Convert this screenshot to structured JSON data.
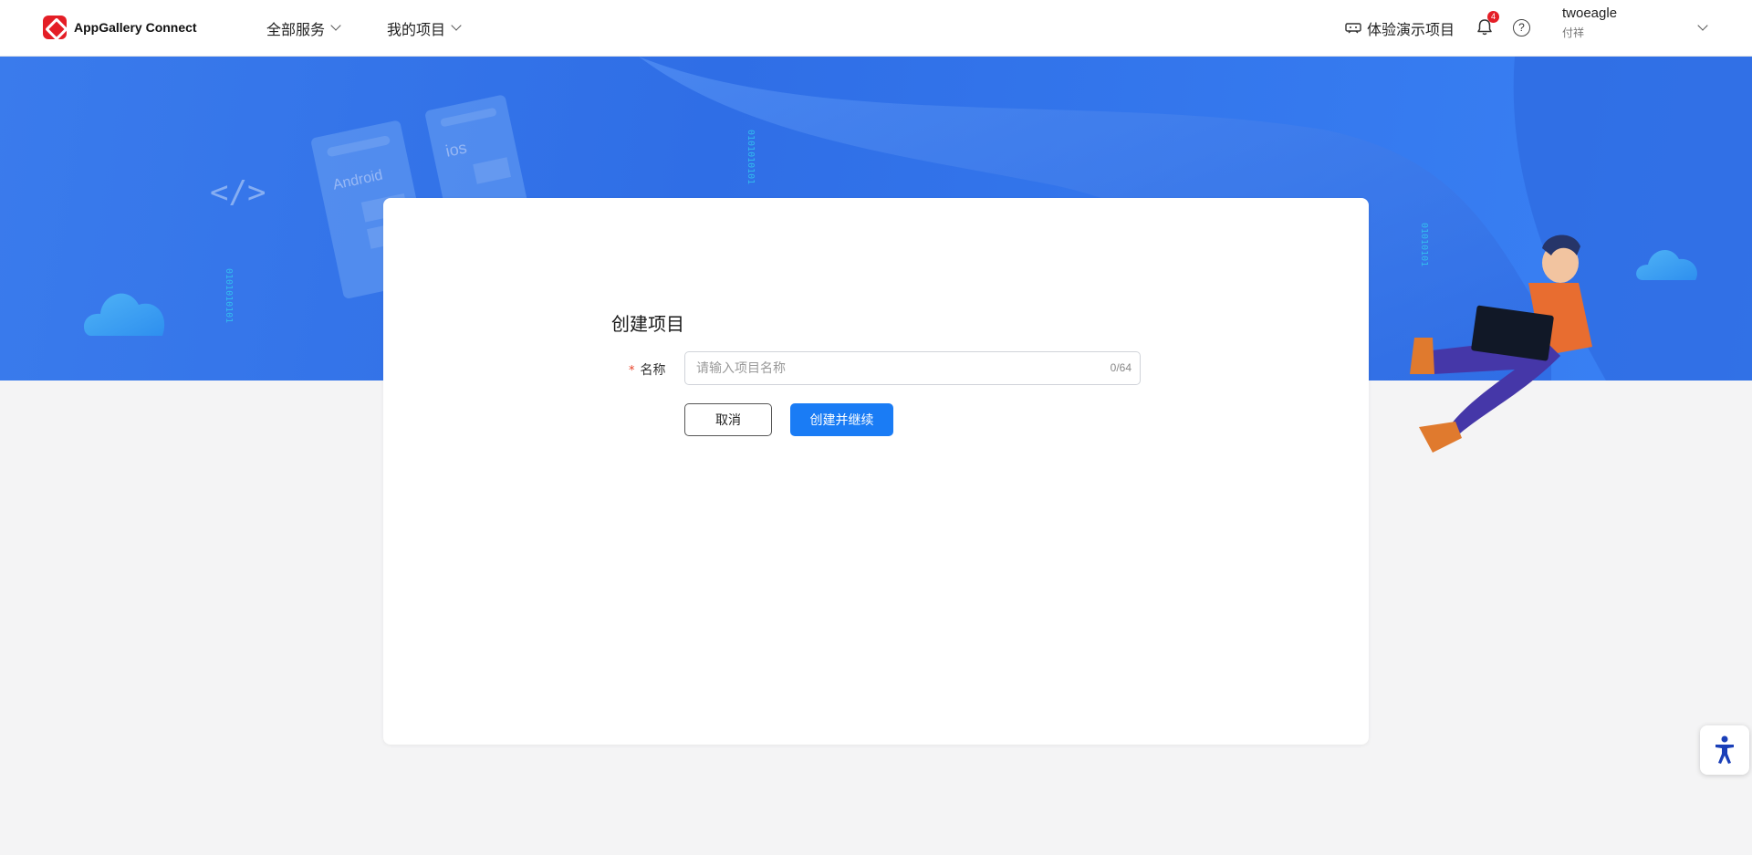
{
  "header": {
    "logo_text": "AppGallery Connect",
    "nav": [
      {
        "label": "全部服务"
      },
      {
        "label": "我的项目"
      }
    ],
    "demo_label": "体验演示项目",
    "notification_count": "4",
    "help_symbol": "?",
    "user": {
      "name": "twoeagle",
      "sub": "付祥"
    }
  },
  "banner": {
    "tiles": [
      "Android",
      "ios"
    ],
    "code_symbol": "</>"
  },
  "form": {
    "title": "创建项目",
    "required_mark": "*",
    "name_label": "名称",
    "name_placeholder": "请输入项目名称",
    "name_value": "",
    "counter": "0/64",
    "cancel_label": "取消",
    "submit_label": "创建并继续"
  },
  "colors": {
    "brand_red": "#e41e26",
    "primary_blue": "#1a7cf5",
    "banner_blue": "#2f6ee6",
    "page_bg": "#f4f4f5"
  },
  "icons": [
    "chevron-down-icon",
    "demo-icon",
    "bell-icon",
    "help-icon",
    "accessibility-icon"
  ]
}
